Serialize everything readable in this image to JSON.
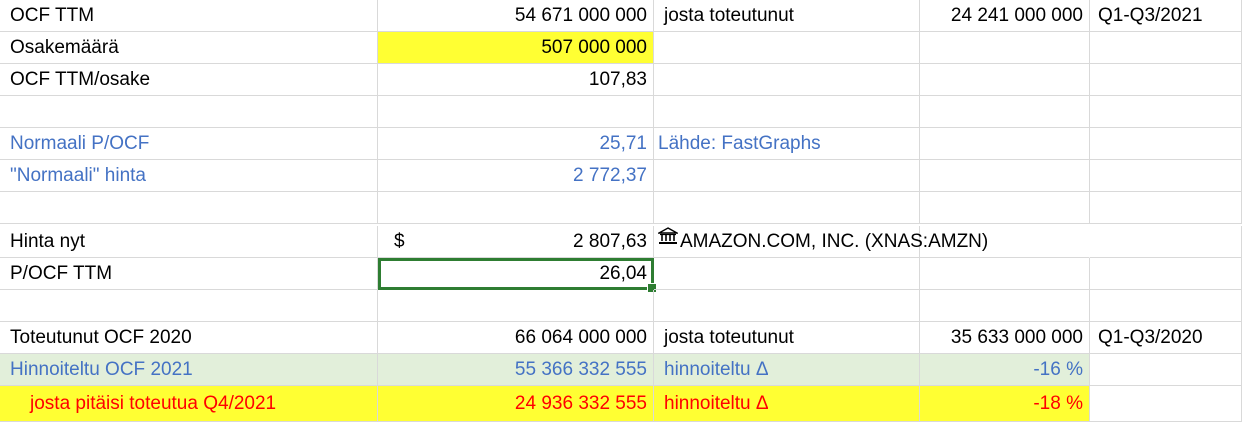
{
  "rows": [
    {
      "a": "OCF TTM",
      "b": "54 671 000 000",
      "c": "josta toteutunut",
      "d": "24 241 000 000",
      "e": "Q1-Q3/2021"
    },
    {
      "a": "Osakemäärä",
      "b": "507 000 000",
      "c": "",
      "d": "",
      "e": ""
    },
    {
      "a": "OCF TTM/osake",
      "b": "107,83",
      "c": "",
      "d": "",
      "e": ""
    },
    {
      "a": "",
      "b": "",
      "c": "",
      "d": "",
      "e": ""
    },
    {
      "a": "Normaali P/OCF",
      "b": "25,71",
      "c": "Lähde: FastGraphs",
      "d": "",
      "e": ""
    },
    {
      "a": "\"Normaali\" hinta",
      "b": "2 772,37",
      "c": "",
      "d": "",
      "e": ""
    },
    {
      "a": "",
      "b": "",
      "c": "",
      "d": "",
      "e": ""
    },
    {
      "a": "Hinta nyt",
      "b_currency": "$",
      "b": "2 807,63",
      "c": "AMAZON.COM, INC. (XNAS:AMZN)",
      "d": "",
      "e": ""
    },
    {
      "a": "P/OCF TTM",
      "b": "26,04",
      "c": "",
      "d": "",
      "e": ""
    },
    {
      "a": "",
      "b": "",
      "c": "",
      "d": "",
      "e": ""
    },
    {
      "a": "Toteutunut OCF 2020",
      "b": "66 064 000 000",
      "c": "josta toteutunut",
      "d": "35 633 000 000",
      "e": "Q1-Q3/2020"
    },
    {
      "a": "Hinnoiteltu OCF 2021",
      "b": "55 366 332 555",
      "c": "hinnoiteltu Δ",
      "d": "-16 %",
      "e": ""
    },
    {
      "a": "josta pitäisi toteutua Q4/2021",
      "b": "24 936 332 555",
      "c": "hinnoiteltu Δ",
      "d": "-18 %",
      "e": ""
    }
  ],
  "colors": {
    "blue": "#4472c4",
    "red": "#ff0000",
    "yellow": "#ffff33",
    "green": "#e2efda",
    "selection": "#2e7d32"
  },
  "icons": {
    "stock_link": "bank-icon"
  }
}
